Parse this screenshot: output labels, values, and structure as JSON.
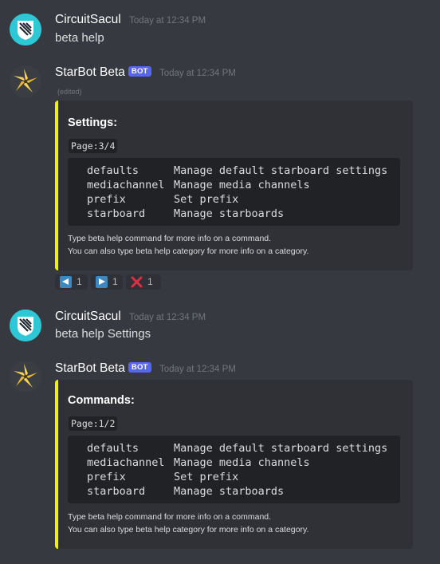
{
  "messages": [
    {
      "author": "CircuitSacul",
      "timestamp": "Today at 12:34 PM",
      "text": "beta help"
    },
    {
      "author": "StarBot Beta",
      "badge": "BOT",
      "timestamp": "Today at 12:34 PM",
      "edited": "(edited)",
      "embed": {
        "title": "Settings:",
        "page": "Page:3/4",
        "commands": [
          {
            "name": "defaults",
            "desc": "Manage default starboard settings"
          },
          {
            "name": "mediachannel",
            "desc": "Manage media channels"
          },
          {
            "name": "prefix",
            "desc": "Set prefix"
          },
          {
            "name": "starboard",
            "desc": "Manage starboards"
          }
        ],
        "footer_line1": "Type beta help command for more info on a command.",
        "footer_line2": "You can also type beta help category for more info on a category.",
        "accent": "#f1f000"
      },
      "reactions": [
        {
          "icon": "arrow-left-icon",
          "count": "1"
        },
        {
          "icon": "arrow-right-icon",
          "count": "1"
        },
        {
          "icon": "red-x-icon",
          "count": "1"
        }
      ]
    },
    {
      "author": "CircuitSacul",
      "timestamp": "Today at 12:34 PM",
      "text": "beta help Settings"
    },
    {
      "author": "StarBot Beta",
      "badge": "BOT",
      "timestamp": "Today at 12:34 PM",
      "embed": {
        "title": "Commands:",
        "page": "Page:1/2",
        "commands": [
          {
            "name": "defaults",
            "desc": "Manage default starboard settings"
          },
          {
            "name": "mediachannel",
            "desc": "Manage media channels"
          },
          {
            "name": "prefix",
            "desc": "Set prefix"
          },
          {
            "name": "starboard",
            "desc": "Manage starboards"
          }
        ],
        "footer_line1": "Type beta help command for more info on a command.",
        "footer_line2": "You can also type beta help category for more info on a category.",
        "accent": "#f1f000"
      }
    }
  ],
  "colors": {
    "background": "#36393f",
    "embed_bg": "#2f3136",
    "code_bg": "#202225",
    "bot_badge": "#5865f2",
    "circuit_avatar": "#2ec7d6"
  }
}
